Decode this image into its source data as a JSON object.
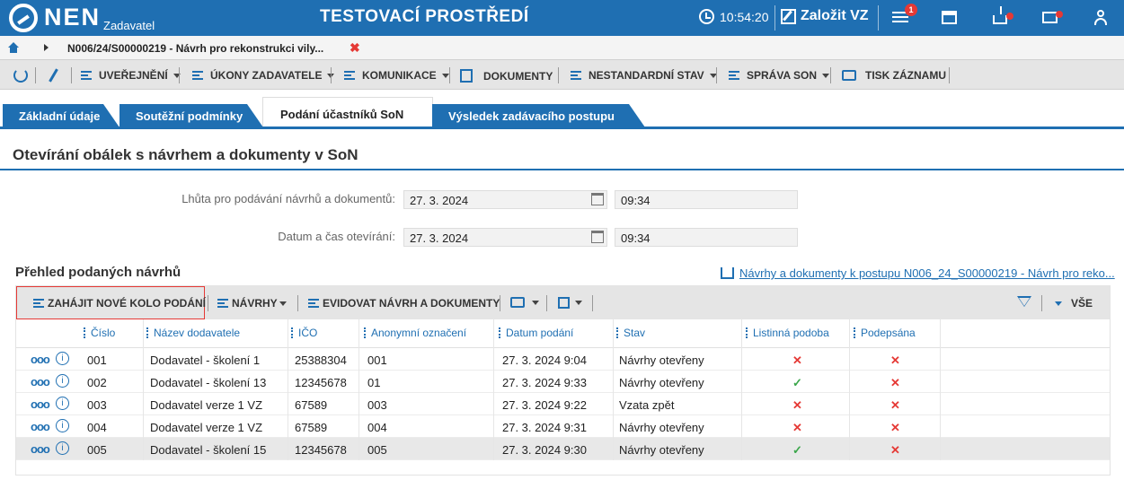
{
  "header": {
    "logo_text": "NEN",
    "logo_sub": "Zadavatel",
    "env_title": "TESTOVACÍ PROSTŘEDÍ",
    "time": "10:54:20",
    "create_label": "Založit VZ",
    "menu_badge": "1",
    "icons": [
      "clock-icon",
      "pencil-square-icon",
      "menu-icon",
      "calculator-icon",
      "inbox-icon",
      "mail-icon",
      "user-icon"
    ],
    "colors": {
      "primary": "#1f6fb2",
      "badge": "#e53935"
    }
  },
  "breadcrumb": {
    "path": "N006/24/S00000219 - Návrh pro rekonstrukci vily..."
  },
  "actionbar": {
    "items": [
      "UVEŘEJNĚNÍ",
      "ÚKONY ZADAVATELE",
      "KOMUNIKACE",
      "DOKUMENTY",
      "NESTANDARDNÍ STAV",
      "SPRÁVA SON",
      "TISK ZÁZNAMU"
    ]
  },
  "tabs": [
    "Základní údaje",
    "Soutěžní podmínky",
    "Podání účastníků SoN",
    "Výsledek zadávacího postupu"
  ],
  "active_tab": "Podání účastníků SoN",
  "section": {
    "title": "Otevírání obálek s návrhem a dokumenty v SoN",
    "fields": {
      "deadline_label": "Lhůta pro podávání návrhů a dokumentů:",
      "deadline_date": "27. 3. 2024",
      "deadline_time": "09:34",
      "opening_label": "Datum a čas otevírání:",
      "opening_date": "27. 3. 2024",
      "opening_time": "09:34"
    }
  },
  "overview": {
    "title": "Přehled podaných návrhů",
    "link": "Návrhy a dokumenty k postupu N006_24_S00000219 - Návrh pro reko..."
  },
  "grid": {
    "toolbar": {
      "new_round": "ZAHÁJIT NOVÉ KOLO PODÁNÍ",
      "proposals": "NÁVRHY",
      "record": "EVIDOVAT NÁVRH A DOKUMENTY",
      "filter_all": "VŠE"
    },
    "columns": [
      "Číslo",
      "Název dodavatele",
      "IČO",
      "Anonymní označení",
      "Datum podání",
      "Stav",
      "Listinná podoba",
      "Podepsána"
    ],
    "rows": [
      {
        "cislo": "001",
        "nazev": "Dodavatel - školení 1",
        "ico": "25388304",
        "anon": "001",
        "datum": "27. 3. 2024 9:04",
        "stav": "Návrhy otevřeny",
        "listinna": "✕",
        "podepsana": "✕"
      },
      {
        "cislo": "002",
        "nazev": "Dodavatel - školení 13",
        "ico": "12345678",
        "anon": "01",
        "datum": "27. 3. 2024 9:33",
        "stav": "Návrhy otevřeny",
        "listinna": "✓",
        "podepsana": "✕"
      },
      {
        "cislo": "003",
        "nazev": "Dodavatel verze 1 VZ",
        "ico": "67589",
        "anon": "003",
        "datum": "27. 3. 2024 9:22",
        "stav": "Vzata zpět",
        "listinna": "✕",
        "podepsana": "✕"
      },
      {
        "cislo": "004",
        "nazev": "Dodavatel verze 1 VZ",
        "ico": "67589",
        "anon": "004",
        "datum": "27. 3. 2024 9:31",
        "stav": "Návrhy otevřeny",
        "listinna": "✕",
        "podepsana": "✕"
      },
      {
        "cislo": "005",
        "nazev": "Dodavatel - školení 15",
        "ico": "12345678",
        "anon": "005",
        "datum": "27. 3. 2024 9:30",
        "stav": "Návrhy otevřeny",
        "listinna": "✓",
        "podepsana": "✕"
      }
    ]
  }
}
